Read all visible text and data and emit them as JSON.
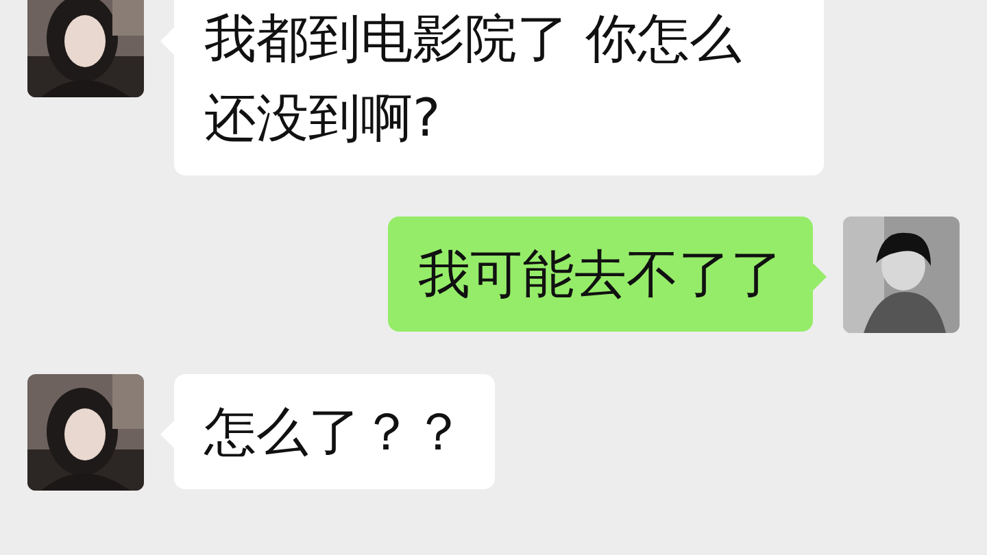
{
  "messages": [
    {
      "kind": "received",
      "text": "我都到电影院了 你怎么还没到啊?"
    },
    {
      "kind": "sent",
      "text": "我可能去不了了"
    },
    {
      "kind": "received",
      "text": "怎么了？？"
    }
  ]
}
